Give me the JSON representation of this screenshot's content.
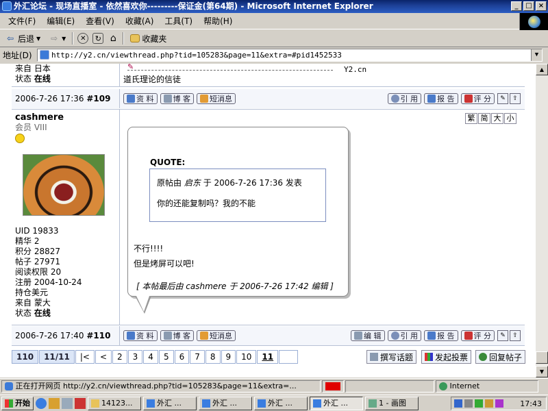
{
  "window": {
    "title": "外汇论坛 - 现场直播室 - 依然喜欢你---------保证金(第64期) - Microsoft Internet Explorer",
    "controls": [
      "_",
      "□",
      "×"
    ]
  },
  "menu": [
    "文件(F)",
    "编辑(E)",
    "查看(V)",
    "收藏(A)",
    "工具(T)",
    "帮助(H)"
  ],
  "toolbar": {
    "back": "后退",
    "favorites": "收藏夹"
  },
  "address": {
    "label": "地址(D)",
    "url": "http://y2.cn/viewthread.php?tid=105283&page=11&extra=#pid1452533"
  },
  "prev_post": {
    "from": "来自 日本",
    "status_label": "状态",
    "status": "在线",
    "sig_site": "Y2.cn",
    "sig_text": "道氏理论的信徒",
    "date": "2006-7-26 17:36",
    "floor": "#109"
  },
  "post_buttons": {
    "profile": "资 料",
    "blog": "博 客",
    "pm": "短消息",
    "edit": "编 辑",
    "quote": "引 用",
    "report": "报 告",
    "rate": "评 分"
  },
  "post": {
    "author": "cashmere",
    "rank": "会员 VIII",
    "text_sizes": [
      "繁",
      "简",
      "大",
      "小"
    ],
    "stats": [
      "UID 19833",
      "精华 2",
      "积分 28827",
      "帖子 27971",
      "阅读权限 20",
      "注册 2004-10-24",
      "持仓美元",
      "来自 蒙大"
    ],
    "status_label": "状态",
    "status": "在线",
    "quote_title": "QUOTE:",
    "quote_header_pre": "原帖由",
    "quote_user": "启东",
    "quote_header_post": "于 2006-7-26 17:36 发表",
    "quote_body": "你的还能复制吗？我的不能",
    "body_line1": "不行!!!!",
    "body_line2": "但是烤屏可以吧!",
    "edit_note": "[ 本帖最后由 cashmere 于 2006-7-26 17:42 编辑 ]",
    "date": "2006-7-26 17:40",
    "floor": "#110"
  },
  "pager": {
    "total": "110",
    "pages": "11/11",
    "first": "|<",
    "prev": "<",
    "numbers": [
      "2",
      "3",
      "4",
      "5",
      "6",
      "7",
      "8",
      "9",
      "10"
    ],
    "current": "11"
  },
  "actions": {
    "new_topic": "撰写话题",
    "new_poll": "发起投票",
    "reply": "回复帖子"
  },
  "statusbar": {
    "text": "正在打开网页 http://y2.cn/viewthread.php?tid=105283&page=11&extra=...",
    "zone": "Internet"
  },
  "taskbar": {
    "start": "开始",
    "tasks": [
      "14123...",
      "外汇 ...",
      "外汇 ...",
      "外汇 ...",
      "外汇 ...",
      "1 - 画图"
    ],
    "clock": "17:43"
  }
}
